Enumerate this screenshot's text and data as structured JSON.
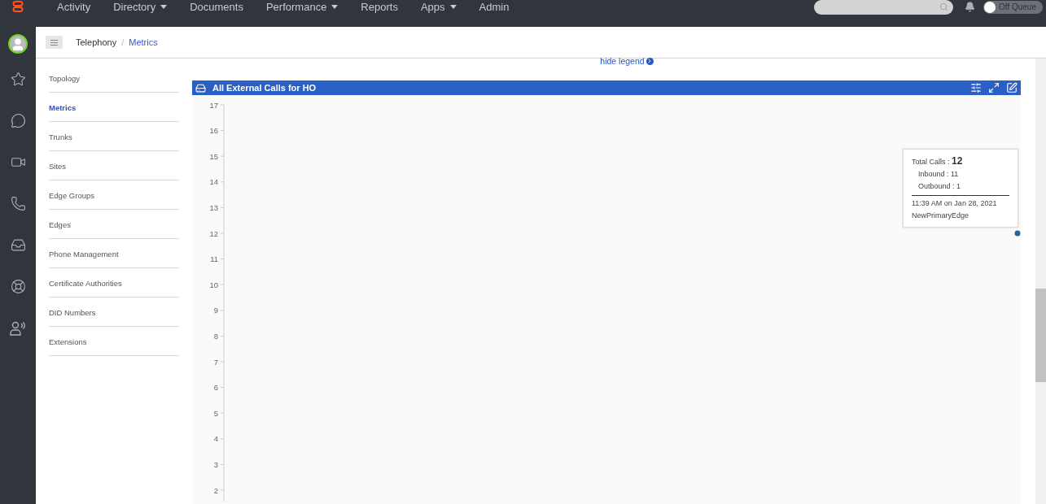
{
  "top_nav": [
    {
      "label": "Activity",
      "has_menu": false
    },
    {
      "label": "Directory",
      "has_menu": true
    },
    {
      "label": "Documents",
      "has_menu": false
    },
    {
      "label": "Performance",
      "has_menu": true
    },
    {
      "label": "Reports",
      "has_menu": false
    },
    {
      "label": "Apps",
      "has_menu": true
    },
    {
      "label": "Admin",
      "has_menu": false
    }
  ],
  "queue_toggle": {
    "label": "Off Queue",
    "on": false
  },
  "breadcrumb_separator": "/",
  "breadcrumb": [
    {
      "label": "Telephony",
      "selected": false
    },
    {
      "label": "Metrics",
      "selected": true
    }
  ],
  "side_nav": [
    {
      "label": "Topology",
      "selected": false
    },
    {
      "label": "Metrics",
      "selected": true
    },
    {
      "label": "Trunks",
      "selected": false
    },
    {
      "label": "Sites",
      "selected": false
    },
    {
      "label": "Edge Groups",
      "selected": false
    },
    {
      "label": "Edges",
      "selected": false
    },
    {
      "label": "Phone Management",
      "selected": false
    },
    {
      "label": "Certificate Authorities",
      "selected": false
    },
    {
      "label": "DID Numbers",
      "selected": false
    },
    {
      "label": "Extensions",
      "selected": false
    }
  ],
  "legend_link": "hide legend",
  "panel": {
    "title": "All External Calls for HO",
    "y_axis_labels": [
      "17",
      "16",
      "15",
      "14",
      "13",
      "12",
      "11",
      "10",
      "9",
      "8",
      "7",
      "6",
      "5",
      "4",
      "3",
      "2"
    ],
    "tooltip": {
      "total_label": "Total Calls :",
      "total_value": "12",
      "lines": [
        "Inbound : 11",
        "Outbound : 1"
      ],
      "time": "11:39 AM on Jan 28, 2021",
      "edge": "NewPrimaryEdge"
    }
  }
}
